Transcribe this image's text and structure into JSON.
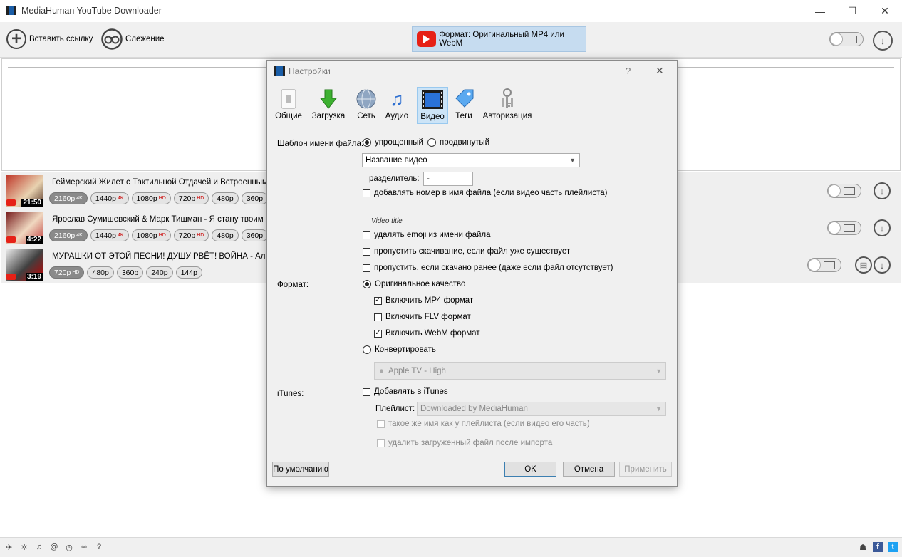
{
  "window": {
    "title": "MediaHuman YouTube Downloader",
    "minimize": "—",
    "maximize": "☐",
    "close": "✕"
  },
  "toolbar": {
    "paste_label": "Вставить ссылку",
    "tracking_label": "Слежение",
    "format_label": "Формат: Оригинальный MP4 или WebM"
  },
  "videos": [
    {
      "title": "Геймерский Жилет с Тактильной Отдачей и Встроенными Д",
      "duration": "21:50",
      "pills": [
        {
          "q": "2160p",
          "b": "4K",
          "sel": true
        },
        {
          "q": "1440p",
          "b": "4K"
        },
        {
          "q": "1080p",
          "b": "HD"
        },
        {
          "q": "720p",
          "b": "HD"
        },
        {
          "q": "480p",
          "b": ""
        },
        {
          "q": "360p",
          "b": ""
        },
        {
          "q": "24",
          "b": ""
        }
      ]
    },
    {
      "title": "Ярослав Сумишевский & Марк Тишман - Я стану твоим Анге",
      "duration": "4:22",
      "pills": [
        {
          "q": "2160p",
          "b": "4K",
          "sel": true
        },
        {
          "q": "1440p",
          "b": "4K"
        },
        {
          "q": "1080p",
          "b": "HD"
        },
        {
          "q": "720p",
          "b": "HD"
        },
        {
          "q": "480p",
          "b": ""
        },
        {
          "q": "360p",
          "b": ""
        },
        {
          "q": "24",
          "b": ""
        }
      ]
    },
    {
      "title": "МУРАШКИ ОТ ЭТОЙ ПЕСНИ! ДУШУ РВЁТ! ВОЙНА - Александ",
      "duration": "3:19",
      "pills": [
        {
          "q": "720p",
          "b": "HD",
          "sel": true
        },
        {
          "q": "480p",
          "b": ""
        },
        {
          "q": "360p",
          "b": ""
        },
        {
          "q": "240p",
          "b": ""
        },
        {
          "q": "144p",
          "b": ""
        }
      ]
    }
  ],
  "dialog": {
    "title": "Настройки",
    "help": "?",
    "close": "✕",
    "tabs": [
      {
        "label": "Общие",
        "icon": "general-icon"
      },
      {
        "label": "Загрузка",
        "icon": "download-arrow-icon"
      },
      {
        "label": "Сеть",
        "icon": "globe-icon"
      },
      {
        "label": "Аудио",
        "icon": "music-note-icon"
      },
      {
        "label": "Видео",
        "icon": "film-icon",
        "selected": true
      },
      {
        "label": "Теги",
        "icon": "tag-icon"
      },
      {
        "label": "Авторизация",
        "icon": "keys-icon"
      }
    ],
    "filename_label": "Шаблон имени файла:",
    "simple_label": "упрощенный",
    "advanced_label": "продвинутый",
    "name_combo": "Название видео",
    "separator_label": "разделитель:",
    "separator_value": "-",
    "add_number_label": "добавлять номер в имя файла (если видео часть плейлиста)",
    "preview_text": "Video title",
    "remove_emoji_label": "удалять emoji из имени файла",
    "skip_exists_label": "пропустить скачивание, если файл уже существует",
    "skip_downloaded_label": "пропустить, если скачано ранее (даже если файл отсутствует)",
    "format_label": "Формат:",
    "original_label": "Оригинальное качество",
    "mp4_label": "Включить MP4 формат",
    "flv_label": "Включить FLV формат",
    "webm_label": "Включить WebM формат",
    "convert_label": "Конвертировать",
    "convert_combo": "Apple TV - High",
    "itunes_label": "iTunes:",
    "add_itunes_label": "Добавлять в iTunes",
    "playlist_label": "Плейлист:",
    "playlist_combo": "Downloaded by MediaHuman",
    "same_name_label": "такое же имя как у плейлиста (если видео его часть)",
    "delete_after_label": "удалить загруженный файл после импорта",
    "defaults_button": "По умолчанию",
    "ok_button": "OK",
    "cancel_button": "Отмена",
    "apply_button": "Применить"
  },
  "colors": {
    "youtube_red": "#e62117",
    "selected_tab": "#cce4f7",
    "format_button": "#c6dcf0"
  }
}
